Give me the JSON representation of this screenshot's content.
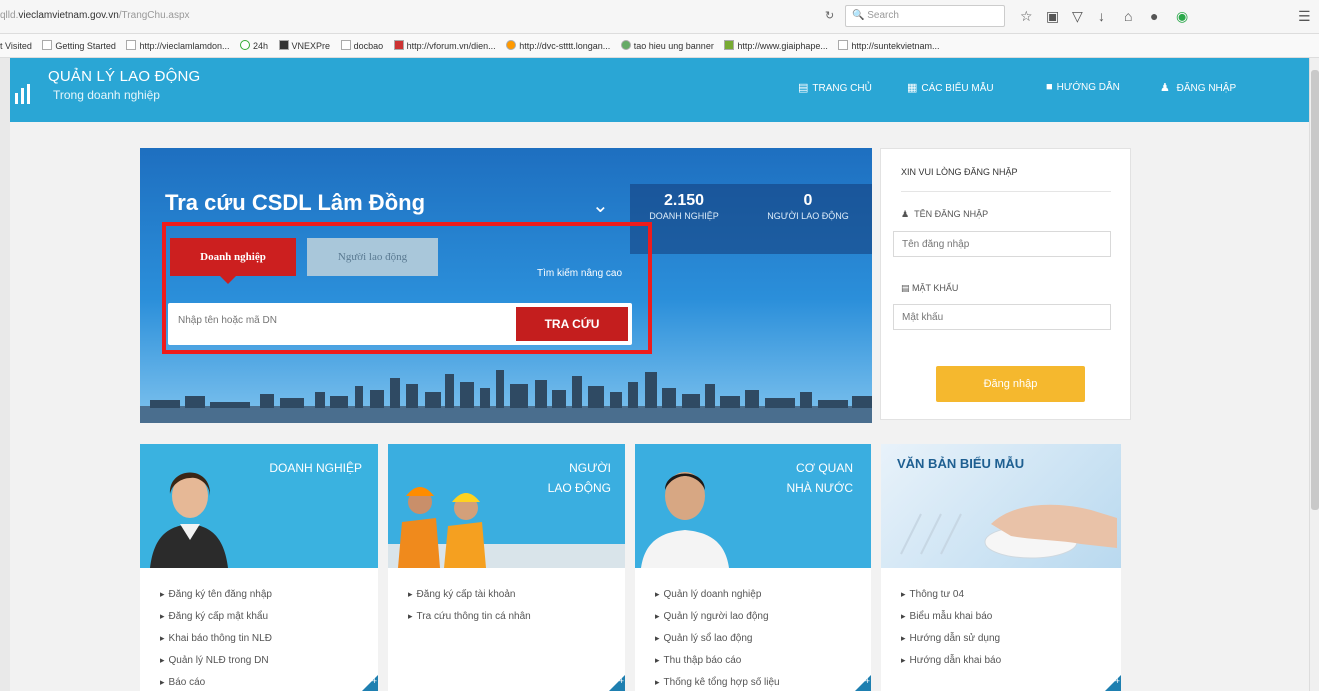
{
  "browser": {
    "url_prefix": "qlld.",
    "url_domain": "vieclamvietnam.gov.vn",
    "url_path": "/TrangChu.aspx",
    "search_placeholder": "Search",
    "bookmarks": [
      "t Visited",
      "Getting Started",
      "http://vieclamlamdon...",
      "24h",
      "VNEXPre",
      "docbao",
      "http://vforum.vn/dien...",
      "http://dvc-stttt.longan...",
      "tao hieu ung banner",
      "http://www.giaiphape...",
      "http://suntekvietnam..."
    ]
  },
  "header": {
    "title": "QUẢN LÝ LAO ĐỘNG",
    "subtitle": "Trong doanh nghiệp",
    "nav": {
      "home": "TRANG CHỦ",
      "forms": "CÁC BIỂU MẪU",
      "guide": "HƯỚNG DẪN",
      "login": "ĐĂNG NHẬP"
    }
  },
  "hero": {
    "title": "Tra cứu CSDL Lâm Đồng",
    "stats": [
      {
        "value": "2.150",
        "label": "DOANH NGHIỆP"
      },
      {
        "value": "0",
        "label": "NGƯỜI LAO ĐỘNG"
      }
    ],
    "tab_business": "Doanh nghiệp",
    "tab_worker": "Người lao động",
    "advanced_search": "Tìm kiếm nâng cao",
    "search_placeholder": "Nhập tên hoặc mã DN",
    "search_button": "TRA CỨU"
  },
  "login": {
    "heading": "XIN VUI LÒNG ĐĂNG NHẬP",
    "username_label": "TÊN ĐĂNG NHẬP",
    "username_placeholder": "Tên đăng nhập",
    "password_label": "MẬT KHẨU",
    "password_placeholder": "Mật khẩu",
    "button": "Đăng nhập"
  },
  "cards": [
    {
      "title_line1": "DOANH NGHIỆP",
      "title_line2": "",
      "color": "#3ab2e0",
      "items": [
        "Đăng ký tên đăng nhập",
        "Đăng ký cấp mật khẩu",
        "Khai báo thông tin NLĐ",
        "Quản lý NLĐ trong DN",
        "Báo cáo"
      ]
    },
    {
      "title_line1": "NGƯỜI",
      "title_line2": "LAO ĐỘNG",
      "color": "#3aaee0",
      "items": [
        "Đăng ký cấp tài khoản",
        "Tra cứu thông tin cá nhân"
      ]
    },
    {
      "title_line1": "CƠ QUAN",
      "title_line2": "NHÀ NƯỚC",
      "color": "#3aaee0",
      "items": [
        "Quản lý doanh nghiệp",
        "Quản lý người lao động",
        "Quản lý sổ lao động",
        "Thu thập báo cáo",
        "Thống kê tổng hợp số liệu"
      ]
    },
    {
      "title_line1": "VĂN BẢN BIỂU MẪU",
      "title_line2": "",
      "color": "#cfe4f3",
      "items": [
        "Thông tư 04",
        "Biểu mẫu khai báo",
        "Hướng dẫn sử dụng",
        "Hướng dẫn khai báo"
      ]
    }
  ],
  "colors": {
    "header": "#2aa6d5",
    "accent_red": "#cc1f1f",
    "login_button": "#f5b82e",
    "highlight_box": "#ee1c1c"
  }
}
